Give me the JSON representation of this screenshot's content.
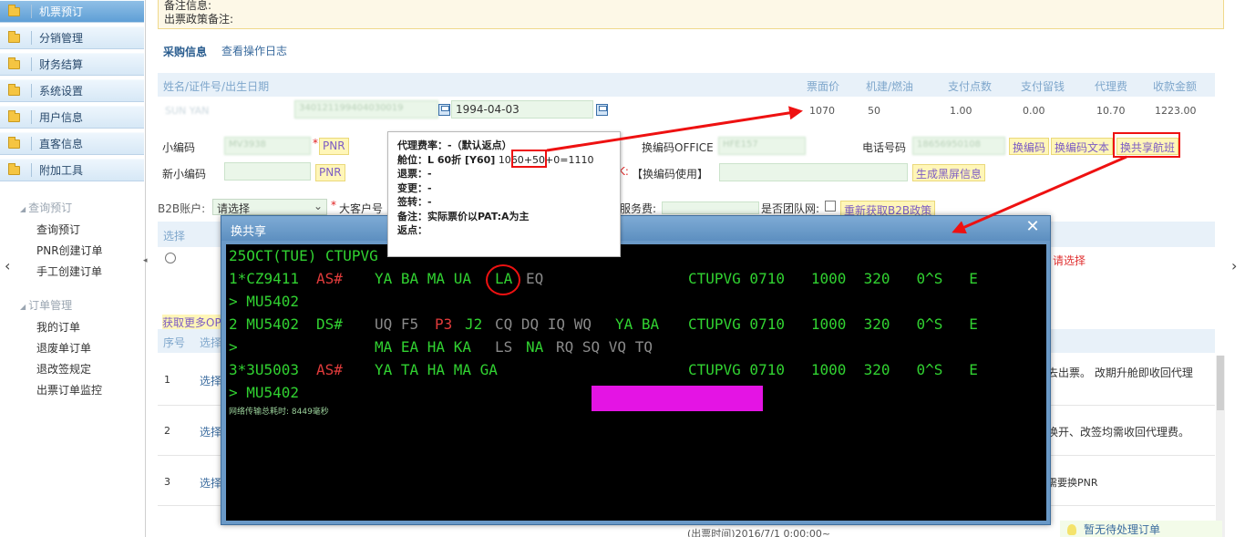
{
  "sidebar": {
    "items": [
      {
        "label": "机票预订"
      },
      {
        "label": "分销管理"
      },
      {
        "label": "财务结算"
      },
      {
        "label": "系统设置"
      },
      {
        "label": "用户信息"
      },
      {
        "label": "直客信息"
      },
      {
        "label": "附加工具"
      }
    ],
    "groups": [
      {
        "title": "查询预订",
        "links": [
          "查询预订",
          "PNR创建订单",
          "手工创建订单"
        ]
      },
      {
        "title": "订单管理",
        "links": [
          "我的订单",
          "退废单订单",
          "退改签规定",
          "出票订单监控"
        ]
      }
    ]
  },
  "note": {
    "line1": "备注信息:",
    "line2": "出票政策备注:"
  },
  "tabs": {
    "active": "采购信息",
    "log": "查看操作日志"
  },
  "passenger_table": {
    "headers": [
      "姓名/证件号/出生日期",
      "票面价",
      "机建/燃油",
      "支付点数",
      "支付留钱",
      "代理费",
      "收款金额"
    ],
    "row": {
      "name": "SUN YAN",
      "id_number": "340121199404030019",
      "birth_date": "1994-04-03",
      "fare": "1070",
      "tax": "50",
      "points": "1.00",
      "retain": "0.00",
      "agent_fee": "10.70",
      "amount": "1223.00"
    }
  },
  "form": {
    "small_code_label": "小编码",
    "small_code_value": "MV3938",
    "pnr_btn": "PNR",
    "new_small_code_label": "新小编码",
    "pnr_btn2": "PNR",
    "office_label": "换编码OFFICE",
    "office_value": "HFE157",
    "phone_label": "电话号码",
    "phone_value": "18656950108",
    "btn_change_code": "换编码",
    "btn_change_code_text": "换编码文本",
    "btn_shared_flight": "换共享航班",
    "use_label_prefix": "K:",
    "use_label": "【换编码使用】",
    "btn_blackscreen": "生成黑屏信息",
    "b2b_label": "B2B账户:",
    "b2b_select": "请选择",
    "big_customer_label": "大客户号",
    "service_fee_label": "服务费:",
    "team_label": "是否团队网:",
    "btn_refetch": "重新获取B2B政策"
  },
  "lower": {
    "select_header": "选择",
    "refetch": "获取更多OP",
    "seq_header": "序号",
    "select_header2": "选择",
    "rows": [
      {
        "no": "1",
        "action": "选择",
        "note": "去出票。 改期升舱即收回代理"
      },
      {
        "no": "2",
        "action": "选择",
        "note": "换开、改签均需收回代理费。"
      },
      {
        "no": "3",
        "action": "选择",
        "note": "需要换PNR"
      }
    ],
    "reselect": "请选择",
    "issue_time": "(出票时间)2016/7/1 0:00:00~"
  },
  "status": {
    "no_pending": "暂无待处理订单"
  },
  "modal": {
    "title": "换共享",
    "lines": {
      "l0": "25OCT(TUE) CTUPVG",
      "l1_no": "1*CZ9411",
      "l1_as": "AS#",
      "l1_cls": "YA BA MA UA",
      "l1_la": "LA",
      "l1_eq": "EQ",
      "l1_route": "CTUPVG 0710   1000  320   0^S   E",
      "l2": "> MU5402",
      "l3_no": "2 MU5402",
      "l3_ds": "DS#",
      "l3_a": "UQ F5",
      "l3_p3": "P3",
      "l3_j2": "J2",
      "l3_g": "CQ DQ IQ WQ",
      "l3_yb": "YA BA",
      "l3_route": "CTUPVG 0710   1000  320   0^S   E",
      "l4_arrow": ">",
      "l4_a": "MA EA HA KA",
      "l4_g": "LS",
      "l4_na": "NA",
      "l4_g2": "RQ SQ VQ TQ",
      "l5_no": "3*3U5003",
      "l5_as": "AS#",
      "l5_cls": "YA TA HA MA GA",
      "l5_route": "CTUPVG 0710   1000  320   0^S   E",
      "l6": "> MU5402",
      "timing": "网络传输总耗时: 8449毫秒"
    }
  },
  "tooltip": {
    "l1": "代理费率：-（默认返点）",
    "l2_pre": "舱位：L   60折   [Y60]",
    "l2_price": "1060",
    "l2_post": "+50+0=1110",
    "l3": "退票：-",
    "l4": "变更：-",
    "l5": "签转：-",
    "l6": "备注：实际票价以PAT:A为主",
    "l7": "返点："
  },
  "colors": {
    "annotation": "#ee1111",
    "terminal_green": "#31d231",
    "modal_header": "#6a99c7"
  }
}
